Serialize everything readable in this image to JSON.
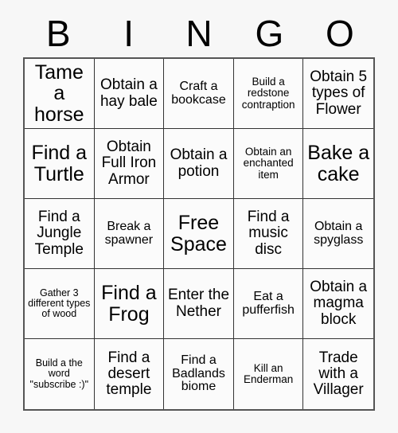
{
  "card": {
    "title_letters": [
      "B",
      "I",
      "N",
      "G",
      "O"
    ],
    "rows": [
      [
        {
          "text": "Tame a horse",
          "size": "t-xl"
        },
        {
          "text": "Obtain a hay bale",
          "size": "t-md"
        },
        {
          "text": "Craft a bookcase",
          "size": "t-sm"
        },
        {
          "text": "Build a redstone contraption",
          "size": "t-xs"
        },
        {
          "text": "Obtain 5 types of Flower",
          "size": "t-md"
        }
      ],
      [
        {
          "text": "Find a Turtle",
          "size": "t-xl"
        },
        {
          "text": "Obtain Full Iron Armor",
          "size": "t-md"
        },
        {
          "text": "Obtain a potion",
          "size": "t-md"
        },
        {
          "text": "Obtain an enchanted item",
          "size": "t-xs"
        },
        {
          "text": "Bake a cake",
          "size": "t-xl"
        }
      ],
      [
        {
          "text": "Find a Jungle Temple",
          "size": "t-md"
        },
        {
          "text": "Break a spawner",
          "size": "t-sm"
        },
        {
          "text": "Free Space",
          "size": "t-xl"
        },
        {
          "text": "Find a music disc",
          "size": "t-md"
        },
        {
          "text": "Obtain a spyglass",
          "size": "t-sm"
        }
      ],
      [
        {
          "text": "Gather 3 different types of wood",
          "size": "t-xxs"
        },
        {
          "text": "Find a Frog",
          "size": "t-xl"
        },
        {
          "text": "Enter the Nether",
          "size": "t-md"
        },
        {
          "text": "Eat a pufferfish",
          "size": "t-sm"
        },
        {
          "text": "Obtain a magma block",
          "size": "t-md"
        }
      ],
      [
        {
          "text": "Build a the word \"subscribe :)\"",
          "size": "t-xxs"
        },
        {
          "text": "Find a desert temple",
          "size": "t-md"
        },
        {
          "text": "Find a Badlands biome",
          "size": "t-sm"
        },
        {
          "text": "Kill an Enderman",
          "size": "t-xs"
        },
        {
          "text": "Trade with a Villager",
          "size": "t-md"
        }
      ]
    ]
  }
}
